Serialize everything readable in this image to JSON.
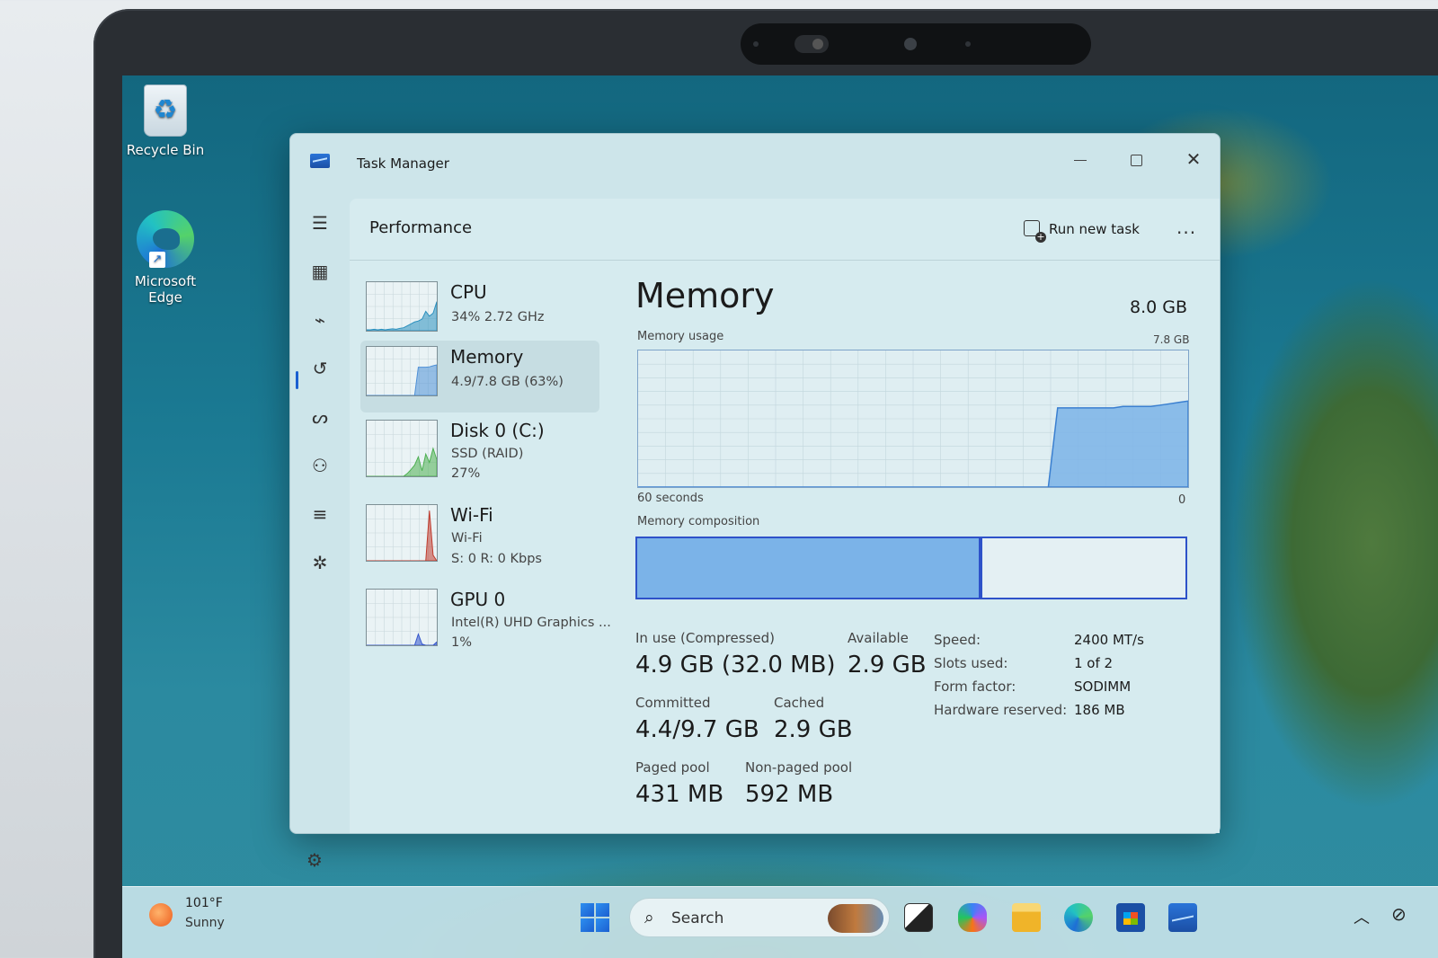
{
  "desktop": {
    "icons": [
      {
        "label": "Recycle Bin",
        "icon": "recycle-bin-icon"
      },
      {
        "label": "Microsoft Edge",
        "icon": "edge-icon"
      }
    ]
  },
  "window": {
    "title": "Task Manager",
    "controls": [
      "minimize",
      "maximize",
      "close"
    ]
  },
  "nav": {
    "items": [
      "hamburger-menu-icon",
      "processes-icon",
      "performance-icon",
      "app-history-icon",
      "startup-apps-icon",
      "users-icon",
      "details-icon",
      "services-icon",
      "settings-icon"
    ],
    "active": "performance-icon"
  },
  "header": {
    "title": "Performance",
    "run_new_task": "Run new task",
    "more": "..."
  },
  "perf_list": [
    {
      "name": "CPU",
      "line1": "34%  2.72 GHz",
      "line2": "",
      "color": "#2a8fbd",
      "series": [
        2,
        2,
        3,
        2,
        3,
        2,
        3,
        4,
        3,
        5,
        6,
        10,
        14,
        18,
        20,
        24,
        40,
        30,
        36,
        60
      ]
    },
    {
      "name": "Memory",
      "line1": "4.9/7.8 GB (63%)",
      "line2": "",
      "color": "#4d8fd6",
      "series": [
        0,
        0,
        0,
        0,
        0,
        0,
        0,
        0,
        0,
        0,
        0,
        0,
        0,
        0,
        58,
        58,
        58,
        59,
        61,
        63
      ]
    },
    {
      "name": "Disk 0 (C:)",
      "line1": "SSD (RAID)",
      "line2": "27%",
      "color": "#4caf50",
      "series": [
        0,
        0,
        0,
        0,
        0,
        0,
        0,
        0,
        0,
        0,
        0,
        5,
        12,
        20,
        35,
        10,
        40,
        25,
        50,
        30
      ]
    },
    {
      "name": "Wi-Fi",
      "line1": "Wi-Fi",
      "line2": "S: 0  R: 0 Kbps",
      "color": "#c0392b",
      "series": [
        0,
        0,
        0,
        0,
        0,
        0,
        0,
        0,
        0,
        0,
        0,
        0,
        0,
        0,
        0,
        0,
        0,
        90,
        10,
        0
      ]
    },
    {
      "name": "GPU 0",
      "line1": "Intel(R) UHD Graphics ...",
      "line2": "1%",
      "color": "#3355cc",
      "series": [
        0,
        0,
        0,
        0,
        0,
        0,
        0,
        0,
        0,
        0,
        0,
        0,
        0,
        0,
        20,
        2,
        0,
        0,
        0,
        6
      ]
    }
  ],
  "memory": {
    "title": "Memory",
    "total": "8.0 GB",
    "usage_label": "Memory usage",
    "usage_max": "7.8 GB",
    "time_label": "60 seconds",
    "time_zero": "0",
    "composition_label": "Memory composition",
    "composition_used_fraction": 0.63,
    "usage_history_pct": [
      0,
      0,
      0,
      0,
      0,
      0,
      0,
      0,
      0,
      0,
      0,
      0,
      0,
      0,
      0,
      0,
      0,
      0,
      0,
      0,
      0,
      0,
      0,
      0,
      0,
      0,
      0,
      0,
      0,
      0,
      0,
      0,
      0,
      0,
      0,
      0,
      0,
      0,
      0,
      0,
      0,
      0,
      0,
      0,
      0,
      58,
      58,
      58,
      58,
      58,
      58,
      58,
      59,
      59,
      59,
      59,
      60,
      61,
      62,
      63
    ],
    "stats": {
      "in_use_label": "In use (Compressed)",
      "in_use_value": "4.9 GB (32.0 MB)",
      "available_label": "Available",
      "available_value": "2.9 GB",
      "committed_label": "Committed",
      "committed_value": "4.4/9.7 GB",
      "cached_label": "Cached",
      "cached_value": "2.9 GB",
      "paged_label": "Paged pool",
      "paged_value": "431 MB",
      "nonpaged_label": "Non-paged pool",
      "nonpaged_value": "592 MB"
    },
    "details": [
      {
        "key": "Speed:",
        "value": "2400 MT/s"
      },
      {
        "key": "Slots used:",
        "value": "1 of 2"
      },
      {
        "key": "Form factor:",
        "value": "SODIMM"
      },
      {
        "key": "Hardware reserved:",
        "value": "186 MB"
      }
    ]
  },
  "taskbar": {
    "weather_temp": "101°F",
    "weather_desc": "Sunny",
    "search_label": "Search",
    "apps": [
      "start-icon",
      "task-view-icon",
      "copilot-icon",
      "file-explorer-icon",
      "edge-icon",
      "store-icon",
      "task-manager-icon"
    ],
    "tray": [
      "chevron-up-icon",
      "network-icon"
    ]
  },
  "colors": {
    "accent": "#2e52c9",
    "memory_fill": "#7bb3e8",
    "window_bg": "#cde5ea"
  }
}
